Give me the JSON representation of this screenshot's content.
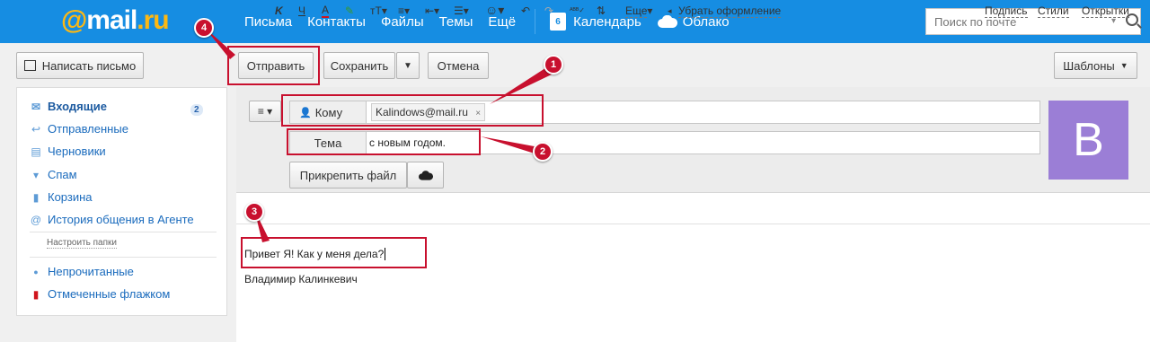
{
  "header": {
    "logo_at": "@",
    "logo_text": "mail",
    "logo_tld": ".ru",
    "nav": [
      "Письма",
      "Контакты",
      "Файлы",
      "Темы",
      "Ещё"
    ],
    "calendar_label": "Календарь",
    "calendar_day": "6",
    "cloud_label": "Облако",
    "search_placeholder": "Поиск по почте"
  },
  "actions": {
    "compose": "Написать письмо",
    "send": "Отправить",
    "save": "Сохранить",
    "cancel": "Отмена",
    "templates": "Шаблоны"
  },
  "sidebar": {
    "items": [
      {
        "label": "Входящие",
        "icon": "envelope-icon",
        "count": "2"
      },
      {
        "label": "Отправленные",
        "icon": "reply-arrow-icon"
      },
      {
        "label": "Черновики",
        "icon": "draft-icon"
      },
      {
        "label": "Спам",
        "icon": "thumbs-down-icon"
      },
      {
        "label": "Корзина",
        "icon": "trash-icon"
      },
      {
        "label": "История общения в Агенте",
        "icon": "agent-icon"
      }
    ],
    "setup_folders": "Настроить папки",
    "filters": [
      {
        "label": "Непрочитанные",
        "icon": "dot-icon"
      },
      {
        "label": "Отмеченные флажком",
        "icon": "flag-icon"
      }
    ]
  },
  "compose": {
    "to_label": "Кому",
    "to_chip": "Kalindows@mail.ru",
    "subject_label": "Тема",
    "subject_value": "с новым годом.",
    "attach_label": "Прикрепить файл",
    "avatar_letter": "В"
  },
  "toolbar": {
    "more": "Еще",
    "clear_format": "Убрать оформление",
    "signature": "Подпись",
    "styles": "Стили",
    "postcards": "Открытки"
  },
  "body": {
    "line1": "Привет Я! Как у меня дела?",
    "line2": "Владимир Калинкевич"
  },
  "markers": [
    "1",
    "2",
    "3",
    "4"
  ],
  "colors": {
    "topbar": "#168de2",
    "accent_red": "#c8102e",
    "avatar": "#9b7ed6"
  }
}
